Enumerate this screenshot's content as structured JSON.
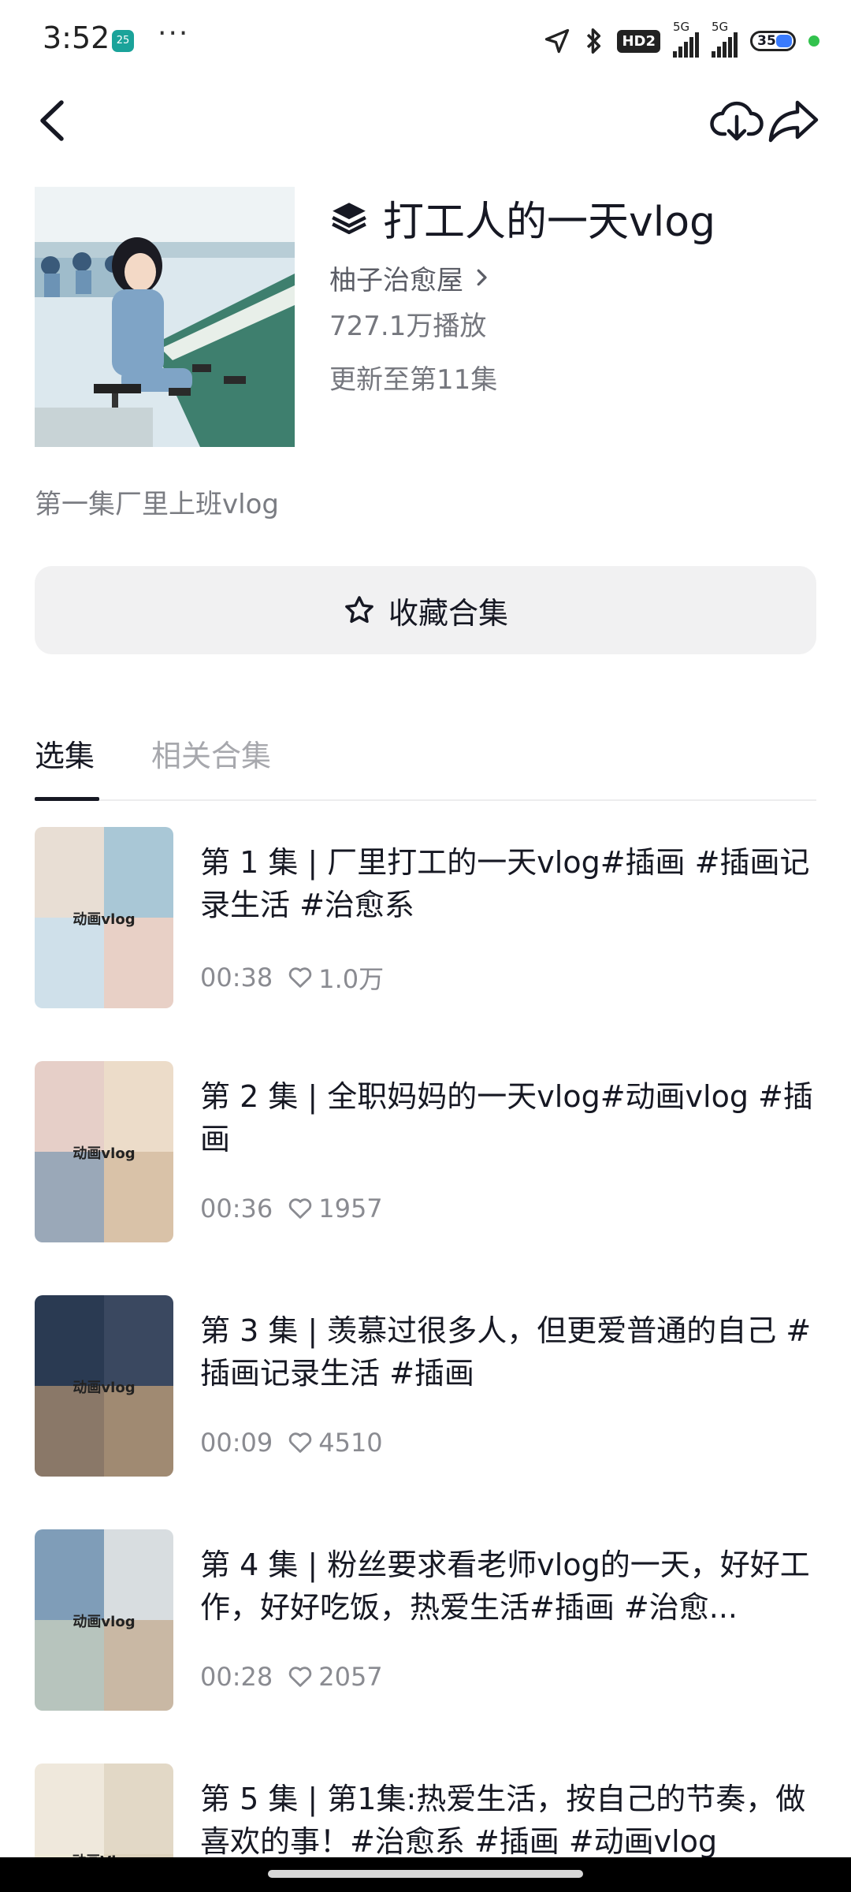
{
  "status_bar": {
    "time": "3:52",
    "app_badge": "25",
    "more": "···",
    "hd": "HD2",
    "net1": "5G",
    "net2": "5G",
    "battery": "35"
  },
  "header": {
    "back_icon": "chevron-left-icon",
    "download_icon": "cloud-download-icon",
    "share_icon": "share-arrow-icon"
  },
  "collection": {
    "icon": "layers-icon",
    "title": "打工人的一天vlog",
    "author": "柚子治愈屋",
    "plays": "727.1万播放",
    "updated": "更新至第11集",
    "description": "第一集厂里上班vlog",
    "favorite_label": "收藏合集"
  },
  "tabs": [
    {
      "label": "选集",
      "active": true
    },
    {
      "label": "相关合集",
      "active": false
    }
  ],
  "episodes": [
    {
      "title": "第 1 集 | 厂里打工的一天vlog#插画 #插画记录生活 #治愈系",
      "duration": "00:38",
      "likes": "1.0万",
      "watermark": "动画vlog"
    },
    {
      "title": "第 2 集 | 全职妈妈的一天vlog#动画vlog #插画",
      "duration": "00:36",
      "likes": "1957",
      "watermark": "动画vlog"
    },
    {
      "title": "第 3 集 | 羡慕过很多人，但更爱普通的自己 #插画记录生活 #插画",
      "duration": "00:09",
      "likes": "4510",
      "watermark": "动画vlog"
    },
    {
      "title": "第 4 集 | 粉丝要求看老师vlog的一天，好好工作，好好吃饭，热爱生活#插画 #治愈...",
      "duration": "00:28",
      "likes": "2057",
      "watermark": "动画vlog"
    },
    {
      "title": "第 5 集 | 第1集:热爱生活，按自己的节奏，做喜欢的事！#治愈系 #插画 #动画vlog",
      "duration": "",
      "likes": "",
      "watermark": "动画Vlog"
    }
  ]
}
